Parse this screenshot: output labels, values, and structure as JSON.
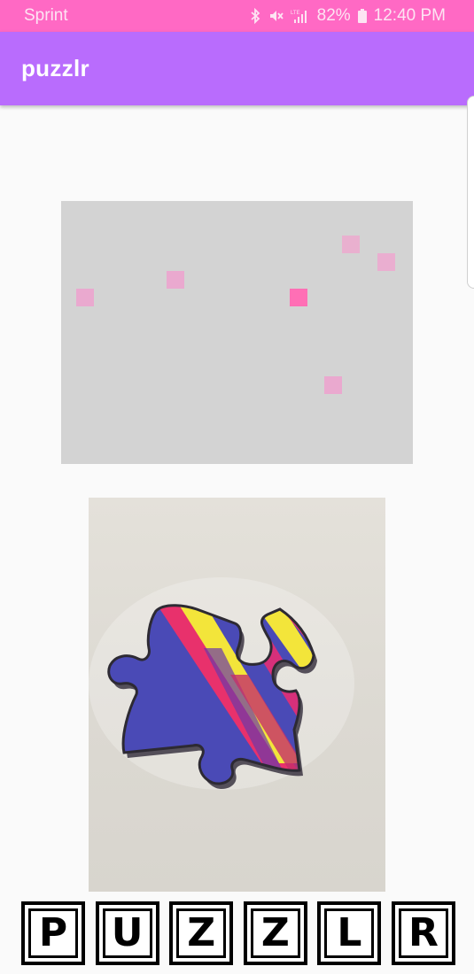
{
  "status_bar": {
    "carrier": "Sprint",
    "battery": "82%",
    "time": "12:40 PM",
    "background": "#ff69c4",
    "icons": [
      "bluetooth-icon",
      "mute-icon",
      "lte-signal-icon",
      "battery-icon"
    ]
  },
  "app_bar": {
    "title": "puzzlr",
    "background": "#b96cfd"
  },
  "grid": {
    "background": "#d3d3d3",
    "cells": [
      {
        "name": "found-cell",
        "color": "#eaa9cf"
      },
      {
        "name": "found-cell",
        "color": "#eaa9cf"
      },
      {
        "name": "found-cell",
        "color": "#e9b0cf"
      },
      {
        "name": "found-cell",
        "color": "#eaaed0"
      },
      {
        "name": "active-cell",
        "color": "#ff6fb5"
      },
      {
        "name": "found-cell",
        "color": "#eaa9cf"
      }
    ]
  },
  "photo": {
    "subject": "puzzle-piece-photo"
  },
  "logo_tiles": [
    "P",
    "U",
    "Z",
    "Z",
    "L",
    "R"
  ]
}
